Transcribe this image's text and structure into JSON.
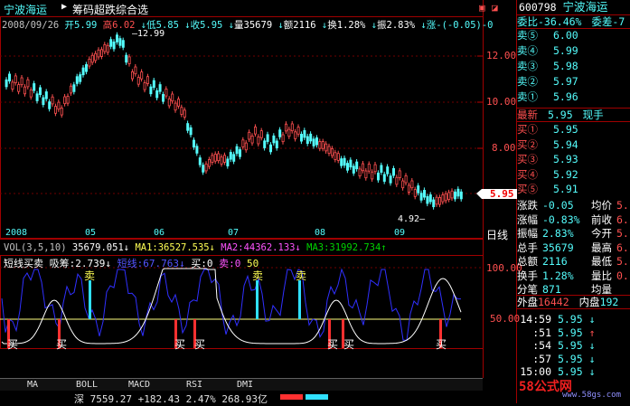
{
  "header": {
    "stock_name": "宁波海运",
    "indicator_title": "筹码超跌综合选",
    "date": "2008/09/26",
    "open_label": "开",
    "open": "5.99",
    "high_label": "高",
    "high": "6.02",
    "low_label": "低",
    "low": "5.85",
    "close_label": "收",
    "close": "5.95",
    "vol_label": "量",
    "vol": "35679",
    "amt_label": "额",
    "amt": "2116",
    "turn_label": "换",
    "turn": "1.28%",
    "amp_label": "振",
    "amp": "2.83%",
    "chg_label": "涨",
    "chg": "-(-0.05)-0"
  },
  "price_axis": {
    "ticks": [
      "12.00",
      "10.00",
      "8.00",
      "6.00"
    ],
    "current": "5.95",
    "max_note": "12.99",
    "min_note": "4.92"
  },
  "time_axis": {
    "labels": [
      "2008",
      "05",
      "06",
      "07",
      "08",
      "09"
    ],
    "period": "日线"
  },
  "vol_line": {
    "name": "VOL(3,5,10)",
    "vol": "35679.051",
    "ma1": "MA1:36527.535",
    "ma2": "MA2:44362.133",
    "ma3": "MA3:31992.734"
  },
  "ind_line": {
    "name": "短线买卖",
    "xichou": "吸筹:2.739",
    "gan": "短线:67.763",
    "buy": "买:0",
    "sell": "卖:0",
    "fifty": "50"
  },
  "ind_axis": {
    "ticks": [
      "100.00",
      "50.00"
    ]
  },
  "ind_marks": {
    "sell": "卖",
    "buy": "买"
  },
  "tabs": [
    "MA",
    "BOLL",
    "MACD",
    "RSI",
    "DMI"
  ],
  "bottom_ticker": "深 7559.27 +182.43 2.47% 268.93亿",
  "right_panel": {
    "code": "600798",
    "name": "宁波海运",
    "webi_label": "委比",
    "webi": "-36.46%",
    "weicha_label": "委差",
    "weicha": "-7",
    "sell_levels": [
      {
        "label": "卖⑤",
        "price": "6.00"
      },
      {
        "label": "卖④",
        "price": "5.99"
      },
      {
        "label": "卖③",
        "price": "5.98"
      },
      {
        "label": "卖②",
        "price": "5.97"
      },
      {
        "label": "卖①",
        "price": "5.96"
      }
    ],
    "latest_label": "最新",
    "latest": "5.95",
    "xianshou": "现手",
    "buy_levels": [
      {
        "label": "买①",
        "price": "5.95"
      },
      {
        "label": "买②",
        "price": "5.94"
      },
      {
        "label": "买③",
        "price": "5.93"
      },
      {
        "label": "买④",
        "price": "5.92"
      },
      {
        "label": "买⑤",
        "price": "5.91"
      }
    ],
    "stats": [
      {
        "l": "涨跌",
        "v": "-0.05",
        "l2": "均价",
        "v2": "5."
      },
      {
        "l": "涨幅",
        "v": "-0.83%",
        "l2": "前收",
        "v2": "6."
      },
      {
        "l": "振幅",
        "v": "2.83%",
        "l2": "今开",
        "v2": "5."
      },
      {
        "l": "总手",
        "v": "35679",
        "l2": "最高",
        "v2": "6."
      },
      {
        "l": "总额",
        "v": "2116",
        "l2": "最低",
        "v2": "5."
      },
      {
        "l": "换手",
        "v": "1.28%",
        "l2": "量比",
        "v2": "0."
      },
      {
        "l": "分笔",
        "v": "871",
        "l2": "均量",
        "v2": ""
      }
    ],
    "outer_label": "外盘",
    "outer": "16442",
    "inner_label": "内盘",
    "inner": "192",
    "ticks": [
      {
        "t": "14:59",
        "p": "5.95",
        "arrow": "↓"
      },
      {
        "t": ":51",
        "p": "5.95",
        "arrow": "↑"
      },
      {
        "t": ":54",
        "p": "5.95",
        "arrow": "↓"
      },
      {
        "t": ":57",
        "p": "5.95",
        "arrow": "↓"
      },
      {
        "t": "15:00",
        "p": "5.95",
        "arrow": "↓"
      }
    ]
  },
  "watermark": {
    "brand": "58公式网",
    "url": "www.58gs.com"
  },
  "colors": {
    "up": "#ff5050",
    "down": "#54fcfc",
    "frame": "#c00000"
  }
}
